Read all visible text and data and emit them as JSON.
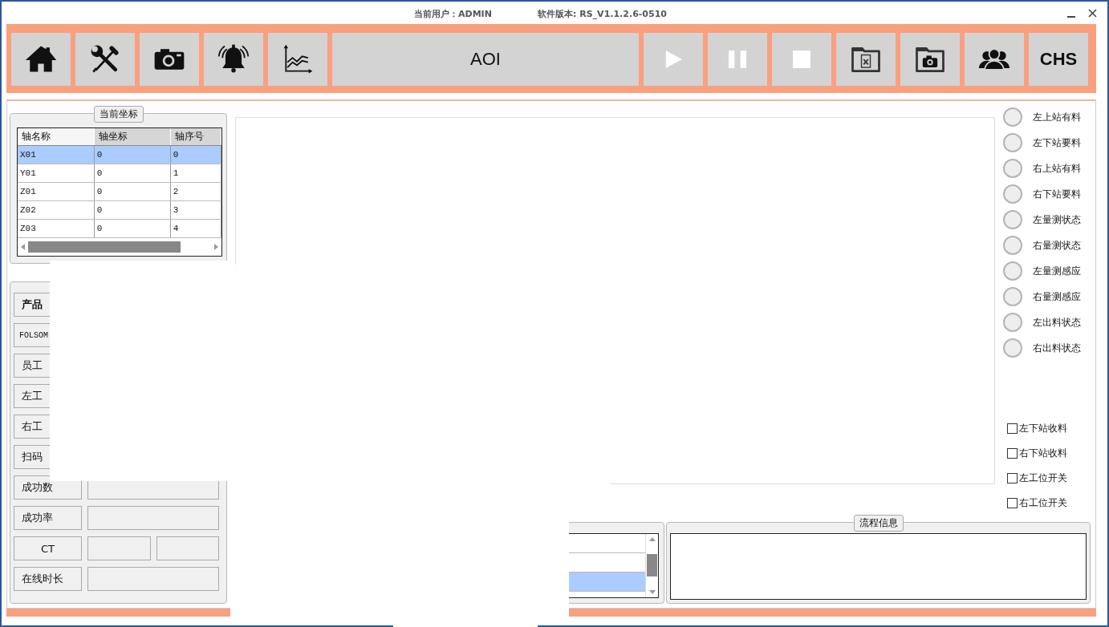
{
  "window": {
    "user": "当前用户：ADMIN",
    "version": "软件版本: RS_V1.1.2.6-0510"
  },
  "toolbar": {
    "title": "AOI",
    "language": "CHS"
  },
  "coordinates": {
    "legend": "当前坐标",
    "columns": [
      "轴名称",
      "轴坐标",
      "轴序号"
    ],
    "rows": [
      {
        "cells": [
          "X01",
          "0",
          "0"
        ],
        "selected": true
      },
      {
        "cells": [
          "Y01",
          "0",
          "1"
        ],
        "selected": false
      },
      {
        "cells": [
          "Z01",
          "0",
          "2"
        ],
        "selected": false
      },
      {
        "cells": [
          "Z02",
          "0",
          "3"
        ],
        "selected": false
      },
      {
        "cells": [
          "Z03",
          "0",
          "4"
        ],
        "selected": false
      }
    ]
  },
  "stats": [
    {
      "label": "产品",
      "kind": "header"
    },
    {
      "label": "FOLSOM",
      "kind": "mono"
    },
    {
      "label": "员工",
      "kind": "plain"
    },
    {
      "label": "左工",
      "kind": "plain"
    },
    {
      "label": "右工",
      "kind": "single"
    },
    {
      "label": "扫码",
      "kind": "single"
    },
    {
      "label": "成功数",
      "kind": "single"
    },
    {
      "label": "成功率",
      "kind": "single"
    },
    {
      "label": "CT",
      "kind": "split"
    },
    {
      "label": "在线时长",
      "kind": "single"
    }
  ],
  "indicators": [
    {
      "label": "左上站有料",
      "on": false
    },
    {
      "label": "左下站要料",
      "on": false
    },
    {
      "label": "右上站有料",
      "on": false
    },
    {
      "label": "右下站要料",
      "on": false
    },
    {
      "label": "左量测状态",
      "on": false
    },
    {
      "label": "右量测状态",
      "on": false
    },
    {
      "label": "左量测感应",
      "on": false
    },
    {
      "label": "右量测感应",
      "on": false
    },
    {
      "label": "左出料状态",
      "on": false
    },
    {
      "label": "右出料状态",
      "on": false
    }
  ],
  "switches": [
    {
      "label": "左下站收料",
      "checked": false
    },
    {
      "label": "右下站收料",
      "checked": false
    },
    {
      "label": "左工位开关",
      "checked": false
    },
    {
      "label": "右工位开关",
      "checked": false
    }
  ],
  "log_list": {
    "rows": [
      {
        "selected": false
      },
      {
        "selected": false
      },
      {
        "selected": true
      }
    ]
  },
  "flow_info": {
    "legend": "流程信息"
  }
}
